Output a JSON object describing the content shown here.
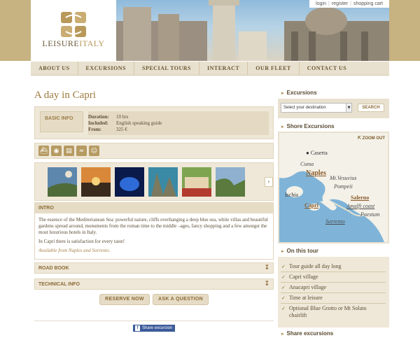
{
  "brand": {
    "name_part1": "LEISURE",
    "name_part2": "ITALY"
  },
  "utility": {
    "login": "login",
    "register": "register",
    "cart": "shopping cart"
  },
  "nav": [
    "ABOUT US",
    "EXCURSIONS",
    "SPECIAL TOURS",
    "INTERACT",
    "OUR FLEET",
    "CONTACT US"
  ],
  "page": {
    "title": "A day in Capri"
  },
  "basic_info": {
    "label": "BASIC INFO",
    "rows": [
      {
        "k": "Duration:",
        "v": "10 hrs"
      },
      {
        "k": "Included:",
        "v": "English speaking guide"
      },
      {
        "k": "From:",
        "v": "325 €"
      }
    ]
  },
  "service_icons": [
    "boat-icon",
    "camera-icon",
    "document-icon",
    "swimmer-icon",
    "group-icon"
  ],
  "gallery": {
    "next_label": "›"
  },
  "intro": {
    "head": "INTRO",
    "p1": "The essence  of the Mediterranean Sea: powerful nature, cliffs overhanging a deep blue sea, white villas and beautiful gardens spread around, monuments from the roman time  to the middle –ages, fancy shopping and a few amongst the most luxurious hotels in Italy.",
    "p2": "In Capri there is satisfaction for every taste!",
    "p3": "Available from Naples and Sorrento."
  },
  "road_book": {
    "label": "ROAD BOOK"
  },
  "technical": {
    "label": "TECHNICAL INFO"
  },
  "buttons": {
    "reserve": "RESERVE NOW",
    "question": "ASK A QUESTION"
  },
  "share": {
    "fb_label": "Share excursion"
  },
  "sidebar": {
    "excursions_title": "Excursions",
    "dest_placeholder": "Select your destination",
    "search_label": "SEARCH",
    "shore_title": "Shore Excursions",
    "zoom_out": "ZOOM OUT",
    "map_labels": {
      "caserta": "Caserta",
      "cuma": "Cuma",
      "naples": "Naples",
      "vesuvius": "Mt.Vesuvius",
      "pompeii": "Pompeii",
      "ischia": "Ischia",
      "salerno": "Salerno",
      "capri": "Capri",
      "amalfi": "Amalfi coast",
      "sorrento": "Sorrento",
      "paestum": "Paestum"
    },
    "on_tour_title": "On this tour",
    "on_tour": [
      "Tour guide all day long",
      "Capri village",
      "Anacapri village",
      "Time at leisure",
      "Optional Blue Grotto or Mt Solato",
      "chairlift"
    ],
    "share_title": "Share excursions"
  }
}
